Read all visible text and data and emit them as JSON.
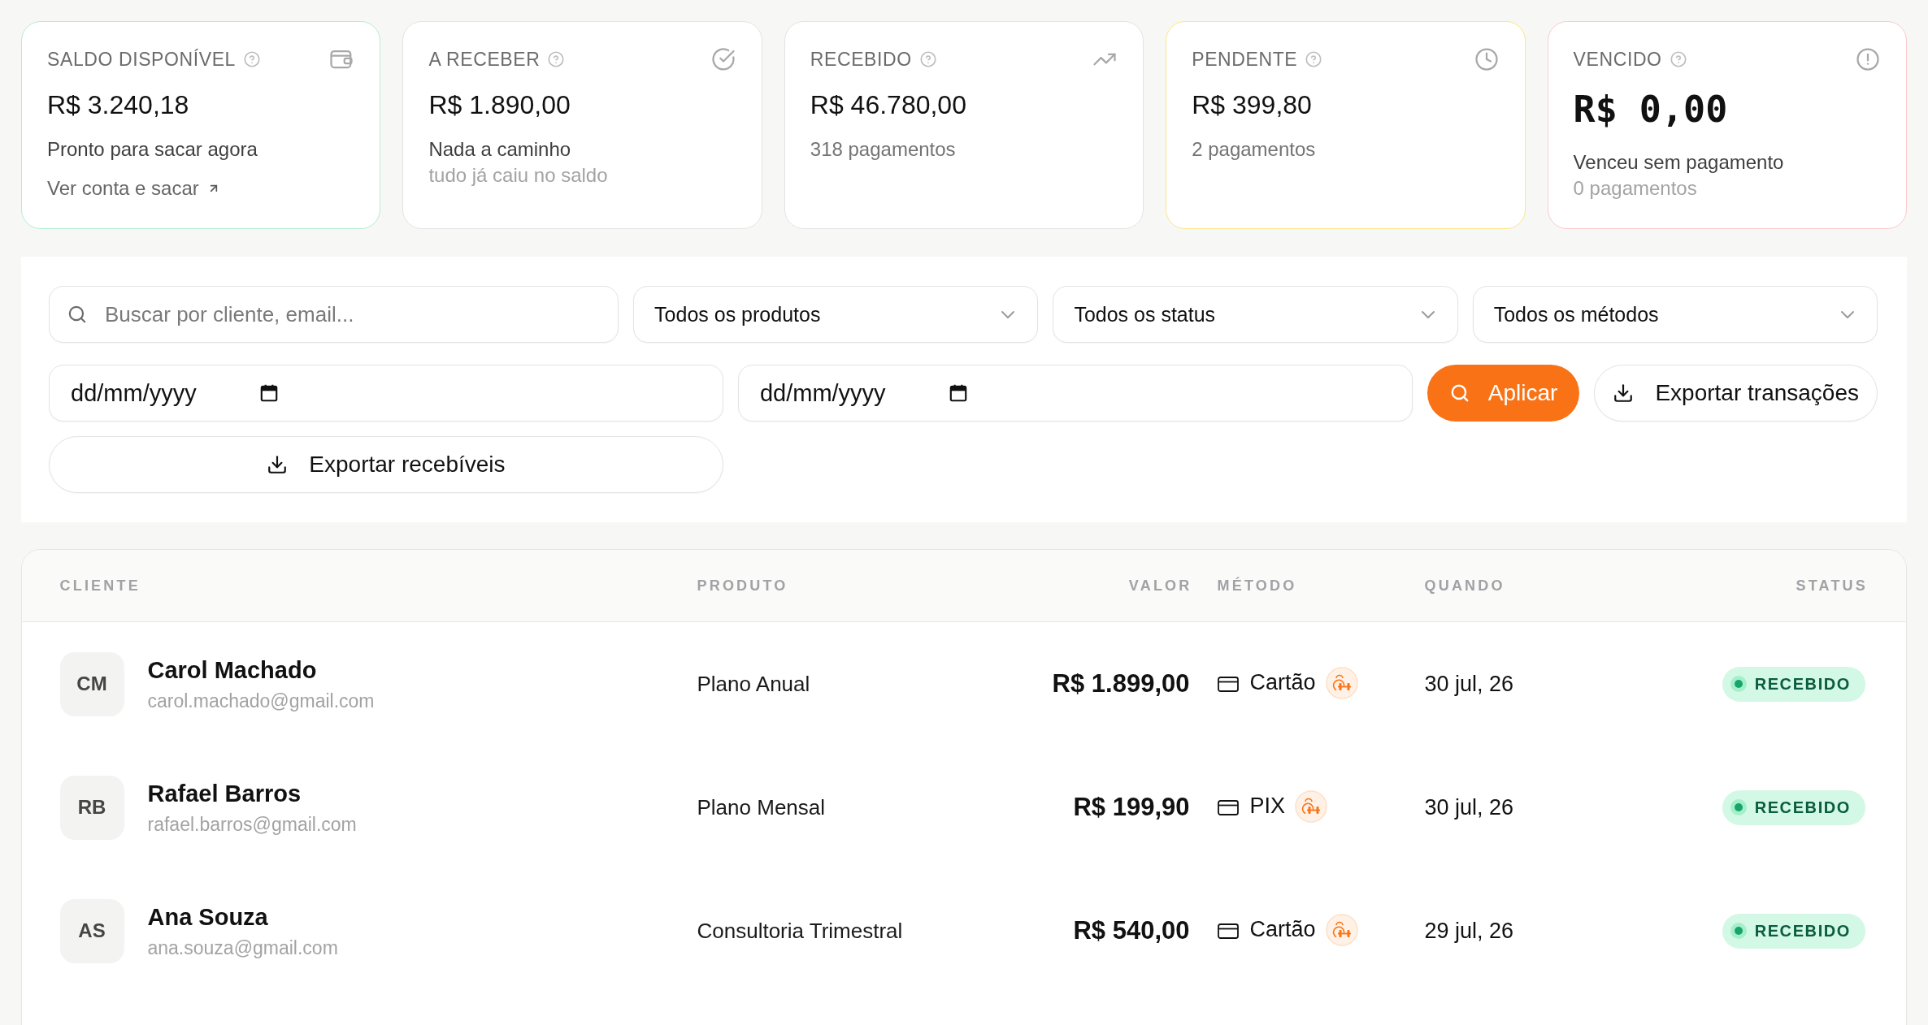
{
  "summary_cards": [
    {
      "kind": "balance",
      "title": "SALDO DISPONÍVEL",
      "amount": "R$ 3.240,18",
      "color": "#b3eed3",
      "lines": [
        {
          "kind": "note",
          "text": "Pronto para sacar agora"
        },
        {
          "kind": "link",
          "text": "Ver conta e sacar"
        }
      ]
    },
    {
      "kind": "receivable",
      "title": "A RECEBER",
      "amount": "R$ 1.890,00",
      "color": "#e4e4e2",
      "lines": [
        {
          "kind": "note",
          "text": "Nada a caminho"
        },
        {
          "kind": "hint",
          "text": "tudo já caiu no saldo"
        }
      ]
    },
    {
      "kind": "received",
      "title": "RECEBIDO",
      "amount": "R$ 46.780,00",
      "color": "#e4e4e2",
      "lines": [
        {
          "kind": "count",
          "text": "318 pagamentos"
        }
      ]
    },
    {
      "kind": "pending",
      "title": "PENDENTE",
      "amount": "R$ 399,80",
      "color": "#fde68a",
      "lines": [
        {
          "kind": "count",
          "text": "2 pagamentos"
        }
      ]
    },
    {
      "kind": "overdue",
      "title": "VENCIDO",
      "amount": "R$ 0,00",
      "color": "#fecaca",
      "lines": [
        {
          "kind": "note",
          "text": "Venceu sem pagamento"
        },
        {
          "kind": "hint",
          "text": "0 pagamentos"
        }
      ]
    }
  ],
  "filters": {
    "search": {
      "placeholder": "Buscar por cliente, email..."
    },
    "selects": [
      {
        "value": "Todos os produtos"
      },
      {
        "value": "Todos os status"
      },
      {
        "value": "Todos os métodos"
      }
    ],
    "date_from": {
      "placeholder": "dd/mm/yyyy"
    },
    "date_to": {
      "placeholder": "dd/mm/yyyy"
    },
    "buttons": [
      {
        "kind": "primary",
        "label": "Aplicar"
      },
      {
        "kind": "export",
        "label": "Exportar transações"
      },
      {
        "kind": "export",
        "label": "Exportar recebíveis"
      }
    ]
  },
  "table": {
    "columns": [
      "CLIENTE",
      "PRODUTO",
      "VALOR",
      "MÉTODO",
      "QUANDO",
      "STATUS"
    ],
    "rows": [
      {
        "initials": "CM",
        "name": "Carol Machado",
        "email": "carol.machado@gmail.com",
        "product": "Plano Anual",
        "amount": "R$ 1.899,00",
        "method": "Cartão",
        "date": "30 jul, 26",
        "status": {
          "kind": "received",
          "label": "RECEBIDO"
        }
      },
      {
        "initials": "RB",
        "name": "Rafael Barros",
        "email": "rafael.barros@gmail.com",
        "product": "Plano Mensal",
        "amount": "R$ 199,90",
        "method": "PIX",
        "date": "30 jul, 26",
        "status": {
          "kind": "received",
          "label": "RECEBIDO"
        }
      },
      {
        "initials": "AS",
        "name": "Ana Souza",
        "email": "ana.souza@gmail.com",
        "product": "Consultoria Trimestral",
        "amount": "R$ 540,00",
        "method": "Cartão",
        "date": "29 jul, 26",
        "status": {
          "kind": "received",
          "label": "RECEBIDO"
        }
      }
    ]
  }
}
